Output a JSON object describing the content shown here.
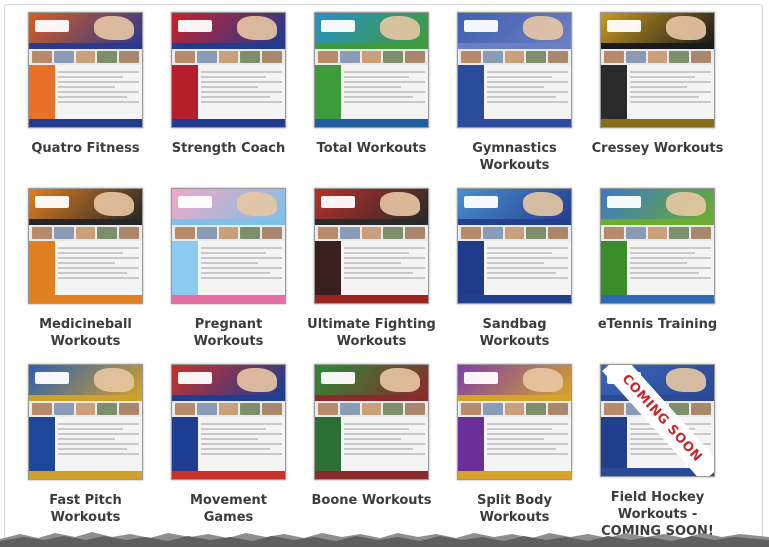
{
  "items": [
    {
      "label": "Quatro Fitness",
      "colors": {
        "header": "#d95d1e",
        "accent": "#2b3a8f",
        "side": "#e8702a",
        "foot": "#233c8c"
      }
    },
    {
      "label": "Strength Coach",
      "colors": {
        "header": "#c9202a",
        "accent": "#203b8f",
        "side": "#b51f2b",
        "foot": "#203b8f"
      }
    },
    {
      "label": "Total Workouts",
      "colors": {
        "header": "#2a8fc8",
        "accent": "#3d9b3a",
        "side": "#3d9b3a",
        "foot": "#1f5f9f"
      }
    },
    {
      "label": "Gymnastics\nWorkouts",
      "colors": {
        "header": "#3f5fb0",
        "accent": "#6a7fc4",
        "side": "#2d4b9c",
        "foot": "#2d4b9c"
      }
    },
    {
      "label": "Cressey Workouts",
      "colors": {
        "header": "#c79a22",
        "accent": "#1b1b1b",
        "side": "#2a2a2a",
        "foot": "#8a6d1a"
      }
    },
    {
      "label": "Medicineball\nWorkouts",
      "colors": {
        "header": "#e07f1f",
        "accent": "#272727",
        "side": "#e07f1f",
        "foot": "#e07f1f"
      }
    },
    {
      "label": "Pregnant\nWorkouts",
      "colors": {
        "header": "#f1a8c6",
        "accent": "#7fc0e8",
        "side": "#8ccbef",
        "foot": "#e46fa3"
      }
    },
    {
      "label": "Ultimate Fighting\nWorkouts",
      "colors": {
        "header": "#b8302a",
        "accent": "#2a2a2a",
        "side": "#3a1f1f",
        "foot": "#9a2420"
      }
    },
    {
      "label": "Sandbag\nWorkouts",
      "colors": {
        "header": "#4a8fd0",
        "accent": "#23408f",
        "side": "#1f3b8a",
        "foot": "#23408f"
      }
    },
    {
      "label": "eTennis Training",
      "colors": {
        "header": "#3c78c6",
        "accent": "#6aad2f",
        "side": "#3b8c2a",
        "foot": "#2f6ab5"
      }
    },
    {
      "label": "Fast Pitch\nWorkouts",
      "colors": {
        "header": "#2a5fb0",
        "accent": "#d0a12a",
        "side": "#20489a",
        "foot": "#d0a12a"
      }
    },
    {
      "label": "Movement\nGames",
      "colors": {
        "header": "#c8302a",
        "accent": "#1f3d93",
        "side": "#1f3d93",
        "foot": "#c8302a"
      }
    },
    {
      "label": "Boone Workouts",
      "colors": {
        "header": "#2c8a3a",
        "accent": "#8a2a2a",
        "side": "#2c6f34",
        "foot": "#8a2a2a"
      }
    },
    {
      "label": "Split Body\nWorkouts",
      "colors": {
        "header": "#7d3fa8",
        "accent": "#d6a22a",
        "side": "#6a2f98",
        "foot": "#d6a22a"
      }
    },
    {
      "label": "Field Hockey\nWorkouts -\nCOMING SOON!",
      "colors": {
        "header": "#3a63b5",
        "accent": "#2a4a96",
        "side": "#223f8e",
        "foot": "#2a4a96"
      },
      "badge": "COMING SOON"
    }
  ]
}
